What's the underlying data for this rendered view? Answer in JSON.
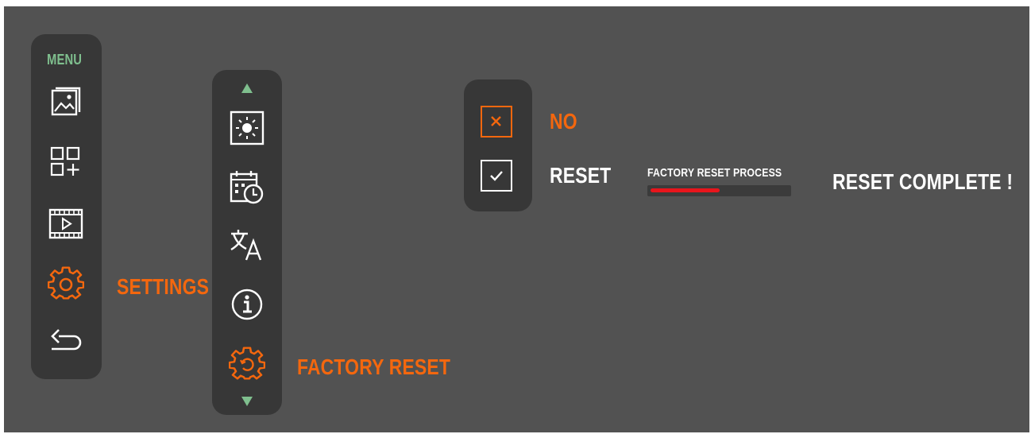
{
  "colors": {
    "background": "#525252",
    "panel": "#373737",
    "accent_orange": "#f4670e",
    "accent_green": "#7fbf8e",
    "progress_fill": "#e8151c",
    "progress_track": "#3b3b3b",
    "icon_white": "#ffffff"
  },
  "main_menu": {
    "title": "MENU",
    "items": [
      {
        "icon": "gallery-icon",
        "selected": false
      },
      {
        "icon": "add-widget-grid-icon",
        "selected": false
      },
      {
        "icon": "video-film-icon",
        "selected": false
      },
      {
        "icon": "settings-gear-icon",
        "selected": true
      },
      {
        "icon": "back-arrow-icon",
        "selected": false
      }
    ],
    "selected_label": "SETTINGS"
  },
  "settings_menu": {
    "scroll_up_icon": "triangle-up-icon",
    "scroll_down_icon": "triangle-down-icon",
    "items": [
      {
        "icon": "brightness-icon",
        "selected": false
      },
      {
        "icon": "calendar-clock-icon",
        "selected": false
      },
      {
        "icon": "language-translate-icon",
        "selected": false
      },
      {
        "icon": "info-icon",
        "selected": false
      },
      {
        "icon": "factory-reset-gear-icon",
        "selected": true
      }
    ],
    "selected_label": "FACTORY RESET"
  },
  "confirm_dialog": {
    "no_label": "NO",
    "reset_label": "RESET"
  },
  "reset_progress": {
    "label": "FACTORY RESET PROCESS",
    "progress": 0.5
  },
  "completion_message": "RESET COMPLETE !"
}
